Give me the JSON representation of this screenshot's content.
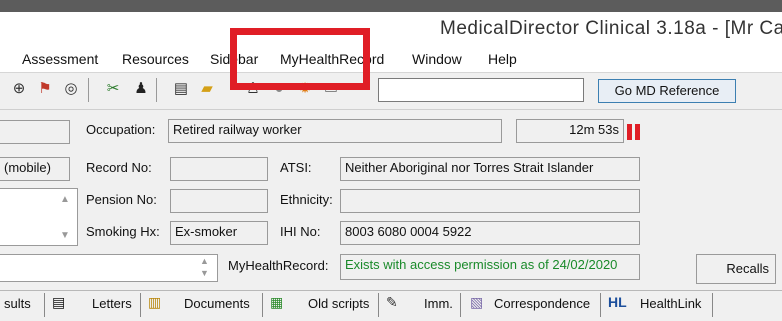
{
  "window": {
    "title": "MedicalDirector Clinical 3.18a - [Mr Ca"
  },
  "menu": {
    "items": [
      "Assessment",
      "Resources",
      "Sidebar",
      "MyHealthRecord",
      "Window",
      "Help"
    ]
  },
  "toolbar": {
    "reference_input_value": "",
    "go_reference_label": "Go MD Reference"
  },
  "patient": {
    "occupation_label": "Occupation:",
    "occupation_value": "Retired railway worker",
    "timer": "12m 53s",
    "left_field_value": "(mobile)",
    "record_no_label": "Record No:",
    "record_no_value": "",
    "atsi_label": "ATSI:",
    "atsi_value": "Neither Aboriginal nor Torres Strait Islander",
    "pension_no_label": "Pension No:",
    "pension_no_value": "",
    "ethnicity_label": "Ethnicity:",
    "ethnicity_value": "",
    "smoking_label": "Smoking Hx:",
    "smoking_value": "Ex-smoker",
    "ihi_label": "IHI No:",
    "ihi_value": "8003 6080 0004 5922",
    "myhealthrecord_label": "MyHealthRecord:",
    "myhealthrecord_value": "Exists with access permission as of 24/02/2020",
    "recalls_label": "Recalls"
  },
  "tabs": [
    {
      "label": "sults",
      "icon": ""
    },
    {
      "label": "Letters",
      "icon": "letters-icon"
    },
    {
      "label": "Documents",
      "icon": "documents-icon"
    },
    {
      "label": "Old scripts",
      "icon": "old-scripts-icon"
    },
    {
      "label": "Imm.",
      "icon": "immunisation-icon"
    },
    {
      "label": "Correspondence",
      "icon": "correspondence-icon"
    },
    {
      "label": "HealthLink",
      "icon": "healthlink-icon"
    }
  ],
  "colors": {
    "highlight_box": "#e01e26",
    "myhealthrecord_text": "#1a8a2a",
    "button_border": "#3c7fb1"
  }
}
